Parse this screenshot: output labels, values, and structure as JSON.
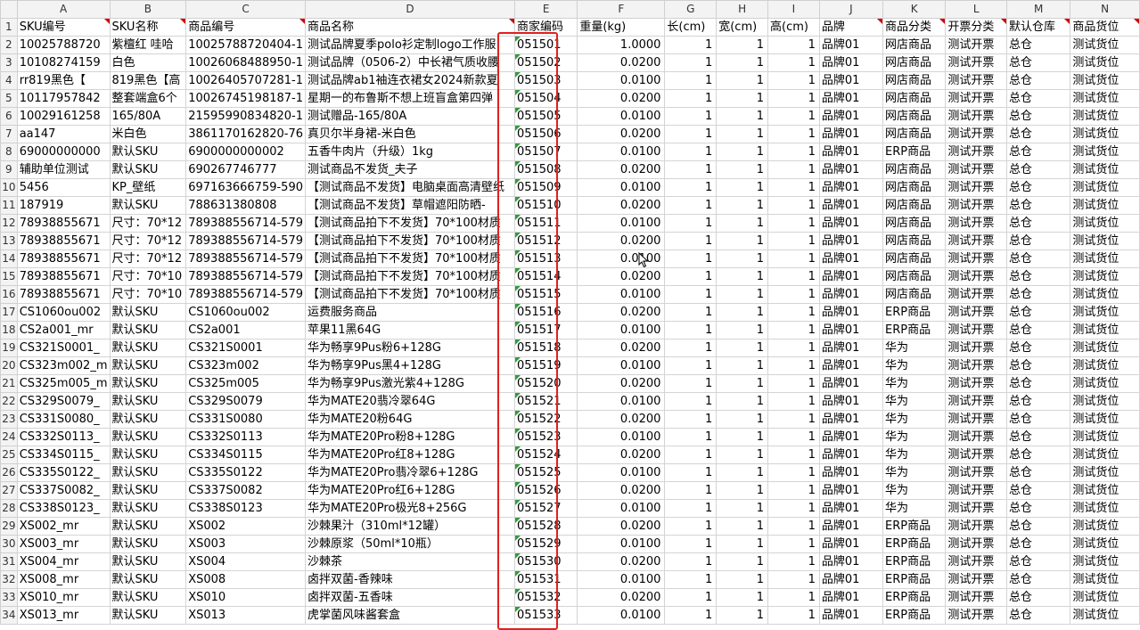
{
  "columns": [
    "A",
    "B",
    "C",
    "D",
    "E",
    "F",
    "G",
    "H",
    "I",
    "J",
    "K",
    "L",
    "M",
    "N"
  ],
  "headers": [
    "SKU编号",
    "SKU名称",
    "商品编号",
    "商品名称",
    "商家编码",
    "重量(kg)",
    "长(cm)",
    "宽(cm)",
    "高(cm)",
    "品牌",
    "商品分类",
    "开票分类",
    "默认仓库",
    "商品货位"
  ],
  "rows": [
    {
      "n": "1"
    },
    {
      "n": "2",
      "a": "10025788720",
      "b": "紫檀红 哇哈",
      "c": "10025788720404-1",
      "d": "测试品牌夏季polo衫定制logo工作服",
      "e": "051501",
      "f": "1.0000",
      "g": "1",
      "h": "1",
      "i": "1",
      "j": "品牌01",
      "k": "网店商品",
      "l": "测试开票",
      "m": "总仓",
      "nn": "测试货位"
    },
    {
      "n": "3",
      "a": "10108274159",
      "b": "白色",
      "c": "10026068488950-1",
      "d": "测试品牌（0506-2）中长裙气质收腰",
      "e": "051502",
      "f": "0.0200",
      "g": "1",
      "h": "1",
      "i": "1",
      "j": "品牌01",
      "k": "网店商品",
      "l": "测试开票",
      "m": "总仓",
      "nn": "测试货位"
    },
    {
      "n": "4",
      "a": "rr819黑色【",
      "b": "819黑色【高",
      "c": "10026405707281-1",
      "d": "测试品牌ab1袖连衣裙女2024新款夏",
      "e": "051503",
      "f": "0.0100",
      "g": "1",
      "h": "1",
      "i": "1",
      "j": "品牌01",
      "k": "网店商品",
      "l": "测试开票",
      "m": "总仓",
      "nn": "测试货位"
    },
    {
      "n": "5",
      "a": "10117957842",
      "b": "整套端盒6个",
      "c": "10026745198187-1",
      "d": "星期一的布鲁斯不想上班盲盒第四弹",
      "e": "051504",
      "f": "0.0200",
      "g": "1",
      "h": "1",
      "i": "1",
      "j": "品牌01",
      "k": "网店商品",
      "l": "测试开票",
      "m": "总仓",
      "nn": "测试货位"
    },
    {
      "n": "6",
      "a": "10029161258",
      "b": "165/80A",
      "c": "21595990834820-1",
      "d": "测试赠品-165/80A",
      "e": "051505",
      "f": "0.0100",
      "g": "1",
      "h": "1",
      "i": "1",
      "j": "品牌01",
      "k": "网店商品",
      "l": "测试开票",
      "m": "总仓",
      "nn": "测试货位"
    },
    {
      "n": "7",
      "a": "aa147",
      "b": "米白色",
      "c": "3861170162820-76",
      "d": "真贝尔半身裙-米白色",
      "e": "051506",
      "f": "0.0200",
      "g": "1",
      "h": "1",
      "i": "1",
      "j": "品牌01",
      "k": "网店商品",
      "l": "测试开票",
      "m": "总仓",
      "nn": "测试货位"
    },
    {
      "n": "8",
      "a": "69000000000",
      "b": "默认SKU",
      "c": "6900000000002",
      "d": "五香牛肉片（升级）1kg",
      "e": "051507",
      "f": "0.0100",
      "g": "1",
      "h": "1",
      "i": "1",
      "j": "品牌01",
      "k": "ERP商品",
      "l": "测试开票",
      "m": "总仓",
      "nn": "测试货位"
    },
    {
      "n": "9",
      "a": "辅助单位测试",
      "b": "默认SKU",
      "c": "690267746777",
      "d": "测试商品不发货_夫子",
      "e": "051508",
      "f": "0.0200",
      "g": "1",
      "h": "1",
      "i": "1",
      "j": "品牌01",
      "k": "网店商品",
      "l": "测试开票",
      "m": "总仓",
      "nn": "测试货位"
    },
    {
      "n": "10",
      "a": "5456",
      "b": "KP_壁纸",
      "c": "697163666759-590",
      "d": "【测试商品不发货】电脑桌面高清壁纸",
      "e": "051509",
      "f": "0.0100",
      "g": "1",
      "h": "1",
      "i": "1",
      "j": "品牌01",
      "k": "网店商品",
      "l": "测试开票",
      "m": "总仓",
      "nn": "测试货位"
    },
    {
      "n": "11",
      "a": "187919",
      "b": "默认SKU",
      "c": "788631380808",
      "d": "【测试商品不发货】草帽遮阳防晒-",
      "e": "051510",
      "f": "0.0200",
      "g": "1",
      "h": "1",
      "i": "1",
      "j": "品牌01",
      "k": "网店商品",
      "l": "测试开票",
      "m": "总仓",
      "nn": "测试货位"
    },
    {
      "n": "12",
      "a": "78938855671",
      "b": "尺寸：70*12",
      "c": "789388556714-579",
      "d": "【测试商品拍下不发货】70*100材质",
      "e": "051511",
      "f": "0.0100",
      "g": "1",
      "h": "1",
      "i": "1",
      "j": "品牌01",
      "k": "网店商品",
      "l": "测试开票",
      "m": "总仓",
      "nn": "测试货位"
    },
    {
      "n": "13",
      "a": "78938855671",
      "b": "尺寸：70*12",
      "c": "789388556714-579",
      "d": "【测试商品拍下不发货】70*100材质",
      "e": "051512",
      "f": "0.0200",
      "g": "1",
      "h": "1",
      "i": "1",
      "j": "品牌01",
      "k": "网店商品",
      "l": "测试开票",
      "m": "总仓",
      "nn": "测试货位"
    },
    {
      "n": "14",
      "a": "78938855671",
      "b": "尺寸：70*12",
      "c": "789388556714-579",
      "d": "【测试商品拍下不发货】70*100材质",
      "e": "051513",
      "f": "0.0100",
      "g": "1",
      "h": "1",
      "i": "1",
      "j": "品牌01",
      "k": "网店商品",
      "l": "测试开票",
      "m": "总仓",
      "nn": "测试货位"
    },
    {
      "n": "15",
      "a": "78938855671",
      "b": "尺寸：70*10",
      "c": "789388556714-579",
      "d": "【测试商品拍下不发货】70*100材质",
      "e": "051514",
      "f": "0.0200",
      "g": "1",
      "h": "1",
      "i": "1",
      "j": "品牌01",
      "k": "网店商品",
      "l": "测试开票",
      "m": "总仓",
      "nn": "测试货位"
    },
    {
      "n": "16",
      "a": "78938855671",
      "b": "尺寸：70*10",
      "c": "789388556714-579",
      "d": "【测试商品拍下不发货】70*100材质",
      "e": "051515",
      "f": "0.0100",
      "g": "1",
      "h": "1",
      "i": "1",
      "j": "品牌01",
      "k": "网店商品",
      "l": "测试开票",
      "m": "总仓",
      "nn": "测试货位"
    },
    {
      "n": "17",
      "a": "CS1060ou002",
      "b": "默认SKU",
      "c": "CS1060ou002",
      "d": "运费服务商品",
      "e": "051516",
      "f": "0.0200",
      "g": "1",
      "h": "1",
      "i": "1",
      "j": "品牌01",
      "k": "ERP商品",
      "l": "测试开票",
      "m": "总仓",
      "nn": "测试货位"
    },
    {
      "n": "18",
      "a": "CS2a001_mr",
      "b": "默认SKU",
      "c": "CS2a001",
      "d": "苹果11黑64G",
      "e": "051517",
      "f": "0.0100",
      "g": "1",
      "h": "1",
      "i": "1",
      "j": "品牌01",
      "k": "ERP商品",
      "l": "测试开票",
      "m": "总仓",
      "nn": "测试货位"
    },
    {
      "n": "19",
      "a": "CS321S0001_",
      "b": "默认SKU",
      "c": "CS321S0001",
      "d": "华为畅享9Pus粉6+128G",
      "e": "051518",
      "f": "0.0200",
      "g": "1",
      "h": "1",
      "i": "1",
      "j": "品牌01",
      "k": "华为",
      "l": "测试开票",
      "m": "总仓",
      "nn": "测试货位"
    },
    {
      "n": "20",
      "a": "CS323m002_m",
      "b": "默认SKU",
      "c": "CS323m002",
      "d": "华为畅享9Pus黑4+128G",
      "e": "051519",
      "f": "0.0100",
      "g": "1",
      "h": "1",
      "i": "1",
      "j": "品牌01",
      "k": "华为",
      "l": "测试开票",
      "m": "总仓",
      "nn": "测试货位"
    },
    {
      "n": "21",
      "a": "CS325m005_m",
      "b": "默认SKU",
      "c": "CS325m005",
      "d": "华为畅享9Pus激光紫4+128G",
      "e": "051520",
      "f": "0.0200",
      "g": "1",
      "h": "1",
      "i": "1",
      "j": "品牌01",
      "k": "华为",
      "l": "测试开票",
      "m": "总仓",
      "nn": "测试货位"
    },
    {
      "n": "22",
      "a": "CS329S0079_",
      "b": "默认SKU",
      "c": "CS329S0079",
      "d": "华为MATE20翡冷翠64G",
      "e": "051521",
      "f": "0.0100",
      "g": "1",
      "h": "1",
      "i": "1",
      "j": "品牌01",
      "k": "华为",
      "l": "测试开票",
      "m": "总仓",
      "nn": "测试货位"
    },
    {
      "n": "23",
      "a": "CS331S0080_",
      "b": "默认SKU",
      "c": "CS331S0080",
      "d": "华为MATE20粉64G",
      "e": "051522",
      "f": "0.0200",
      "g": "1",
      "h": "1",
      "i": "1",
      "j": "品牌01",
      "k": "华为",
      "l": "测试开票",
      "m": "总仓",
      "nn": "测试货位"
    },
    {
      "n": "24",
      "a": "CS332S0113_",
      "b": "默认SKU",
      "c": "CS332S0113",
      "d": "华为MATE20Pro粉8+128G",
      "e": "051523",
      "f": "0.0100",
      "g": "1",
      "h": "1",
      "i": "1",
      "j": "品牌01",
      "k": "华为",
      "l": "测试开票",
      "m": "总仓",
      "nn": "测试货位"
    },
    {
      "n": "25",
      "a": "CS334S0115_",
      "b": "默认SKU",
      "c": "CS334S0115",
      "d": "华为MATE20Pro红8+128G",
      "e": "051524",
      "f": "0.0200",
      "g": "1",
      "h": "1",
      "i": "1",
      "j": "品牌01",
      "k": "华为",
      "l": "测试开票",
      "m": "总仓",
      "nn": "测试货位"
    },
    {
      "n": "26",
      "a": "CS335S0122_",
      "b": "默认SKU",
      "c": "CS335S0122",
      "d": "华为MATE20Pro翡冷翠6+128G",
      "e": "051525",
      "f": "0.0100",
      "g": "1",
      "h": "1",
      "i": "1",
      "j": "品牌01",
      "k": "华为",
      "l": "测试开票",
      "m": "总仓",
      "nn": "测试货位"
    },
    {
      "n": "27",
      "a": "CS337S0082_",
      "b": "默认SKU",
      "c": "CS337S0082",
      "d": "华为MATE20Pro红6+128G",
      "e": "051526",
      "f": "0.0200",
      "g": "1",
      "h": "1",
      "i": "1",
      "j": "品牌01",
      "k": "华为",
      "l": "测试开票",
      "m": "总仓",
      "nn": "测试货位"
    },
    {
      "n": "28",
      "a": "CS338S0123_",
      "b": "默认SKU",
      "c": "CS338S0123",
      "d": "华为MATE20Pro极光8+256G",
      "e": "051527",
      "f": "0.0100",
      "g": "1",
      "h": "1",
      "i": "1",
      "j": "品牌01",
      "k": "华为",
      "l": "测试开票",
      "m": "总仓",
      "nn": "测试货位"
    },
    {
      "n": "29",
      "a": "XS002_mr",
      "b": "默认SKU",
      "c": "XS002",
      "d": "沙棘果汁（310ml*12罐）",
      "e": "051528",
      "f": "0.0200",
      "g": "1",
      "h": "1",
      "i": "1",
      "j": "品牌01",
      "k": "ERP商品",
      "l": "测试开票",
      "m": "总仓",
      "nn": "测试货位"
    },
    {
      "n": "30",
      "a": "XS003_mr",
      "b": "默认SKU",
      "c": "XS003",
      "d": "沙棘原浆（50ml*10瓶）",
      "e": "051529",
      "f": "0.0100",
      "g": "1",
      "h": "1",
      "i": "1",
      "j": "品牌01",
      "k": "ERP商品",
      "l": "测试开票",
      "m": "总仓",
      "nn": "测试货位"
    },
    {
      "n": "31",
      "a": "XS004_mr",
      "b": "默认SKU",
      "c": "XS004",
      "d": "沙棘茶",
      "e": "051530",
      "f": "0.0200",
      "g": "1",
      "h": "1",
      "i": "1",
      "j": "品牌01",
      "k": "ERP商品",
      "l": "测试开票",
      "m": "总仓",
      "nn": "测试货位"
    },
    {
      "n": "32",
      "a": "XS008_mr",
      "b": "默认SKU",
      "c": "XS008",
      "d": "卤拌双菌-香辣味",
      "e": "051531",
      "f": "0.0100",
      "g": "1",
      "h": "1",
      "i": "1",
      "j": "品牌01",
      "k": "ERP商品",
      "l": "测试开票",
      "m": "总仓",
      "nn": "测试货位"
    },
    {
      "n": "33",
      "a": "XS010_mr",
      "b": "默认SKU",
      "c": "XS010",
      "d": "卤拌双菌-五香味",
      "e": "051532",
      "f": "0.0200",
      "g": "1",
      "h": "1",
      "i": "1",
      "j": "品牌01",
      "k": "ERP商品",
      "l": "测试开票",
      "m": "总仓",
      "nn": "测试货位"
    },
    {
      "n": "34",
      "a": "XS013_mr",
      "b": "默认SKU",
      "c": "XS013",
      "d": "虎掌菌风味酱套盒",
      "e": "051533",
      "f": "0.0100",
      "g": "1",
      "h": "1",
      "i": "1",
      "j": "品牌01",
      "k": "ERP商品",
      "l": "测试开票",
      "m": "总仓",
      "nn": "测试货位"
    }
  ],
  "colors": {
    "highlight_border": "#e02020",
    "comment_marker": "#d00000",
    "text_marker": "#2e9e3b"
  }
}
